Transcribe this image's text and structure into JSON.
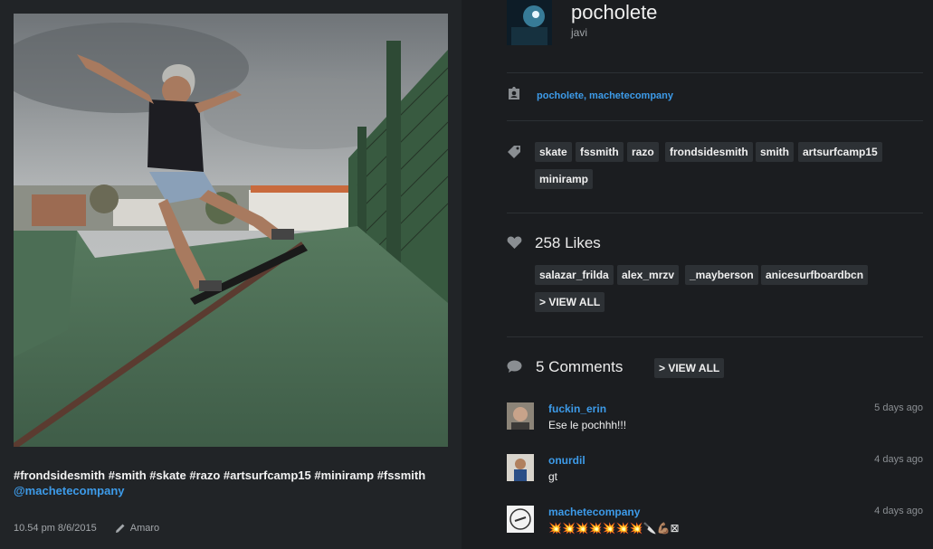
{
  "post": {
    "caption_tags": "#frondsidesmith #smith #skate #razo #artsurfcamp15 #miniramp #fssmith",
    "caption_mention": "@machetecompany",
    "timestamp": "10.54 pm 8/6/2015",
    "filter": "Amaro"
  },
  "user": {
    "username": "pocholete",
    "fullname": "javi"
  },
  "tagged_users": "pocholete,  machetecompany",
  "tags": [
    "skate",
    "fssmith",
    "razo",
    "frondsidesmith",
    "smith",
    "artsurfcamp15",
    "miniramp"
  ],
  "likes": {
    "title": "258 Likes",
    "users": [
      "salazar_frilda",
      "alex_mrzv",
      "_mayberson",
      "anicesurfboardbcn"
    ],
    "view_all": "> VIEW ALL"
  },
  "comments": {
    "title": "5 Comments",
    "view_all": "> VIEW ALL",
    "items": [
      {
        "user": "fuckin_erin",
        "text": "Ese le pochhh!!!",
        "time": "5 days ago"
      },
      {
        "user": "onurdil",
        "text": "gt",
        "time": "4 days ago"
      },
      {
        "user": "machetecompany",
        "text": "💥💥💥💥💥💥💥🔪💪🏽⊠",
        "time": "4 days ago"
      }
    ]
  },
  "icons": {
    "tagged": "person-tag-icon",
    "tags": "price-tag-icon",
    "likes": "heart-icon",
    "comments": "speech-bubble-icon",
    "filter": "pencil-icon"
  },
  "colors": {
    "accent": "#3d9be9",
    "background": "#1b1d20",
    "pill": "#2d3135"
  }
}
